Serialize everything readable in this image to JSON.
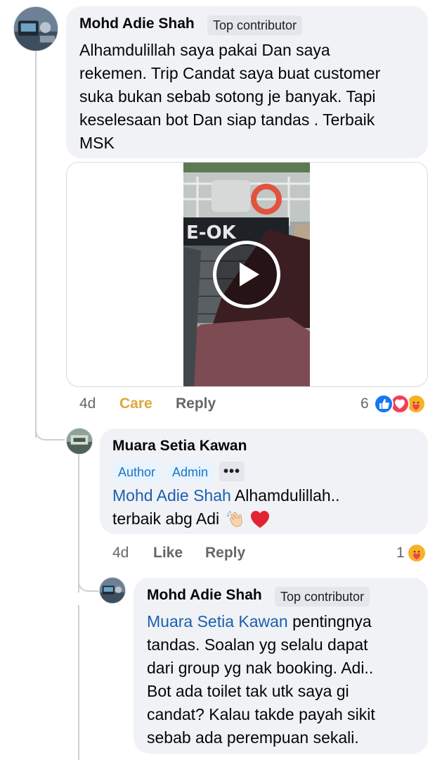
{
  "comment1": {
    "author": "Mohd Adie Shah",
    "badge": "Top contributor",
    "lines": [
      "Alhamdulillah saya pakai Dan saya",
      "rekemen. Trip Candat saya buat customer",
      "suka bukan sebab sotong je banyak. Tapi",
      "keselesaan bot Dan siap tandas . Terbaik",
      "MSK"
    ],
    "video": {
      "icon": "play-icon"
    },
    "actions": {
      "time": "4d",
      "reaction": "Care",
      "reply": "Reply"
    },
    "reactions": {
      "count": "6",
      "icons": [
        "like-icon",
        "love-icon",
        "care-icon"
      ]
    }
  },
  "reply1": {
    "author": "Muara Setia Kawan",
    "badges": [
      "Author",
      "Admin"
    ],
    "more_label": "•••",
    "mention": "Mohd Adie Shah",
    "line1_rest": " Alhamdulillah..",
    "line2": "terbaik abg Adi ",
    "emojis": [
      "clapping-hands",
      "red-heart"
    ],
    "actions": {
      "time": "4d",
      "like": "Like",
      "reply": "Reply"
    },
    "reactions": {
      "count": "1",
      "icons": [
        "care-icon"
      ]
    }
  },
  "reply2": {
    "author": "Mohd Adie Shah",
    "badge": "Top contributor",
    "mention": "Muara Setia Kawan",
    "line1_rest": " pentingnya",
    "lines": [
      "tandas. Soalan yg selalu dapat",
      "dari group yg nak booking. Adi..",
      "Bot ada toilet tak utk saya gi",
      "candat? Kalau takde payah sikit",
      "sebab ada perempuan sekali."
    ]
  },
  "colors": {
    "bubble": "#f0f2f5",
    "mention": "#1b5fb2",
    "care_text": "#dfa63a",
    "meta_text": "#65676b",
    "like_blue": "#1877f2",
    "love_red": "#f33e58",
    "care_yellow": "#f7b125"
  }
}
